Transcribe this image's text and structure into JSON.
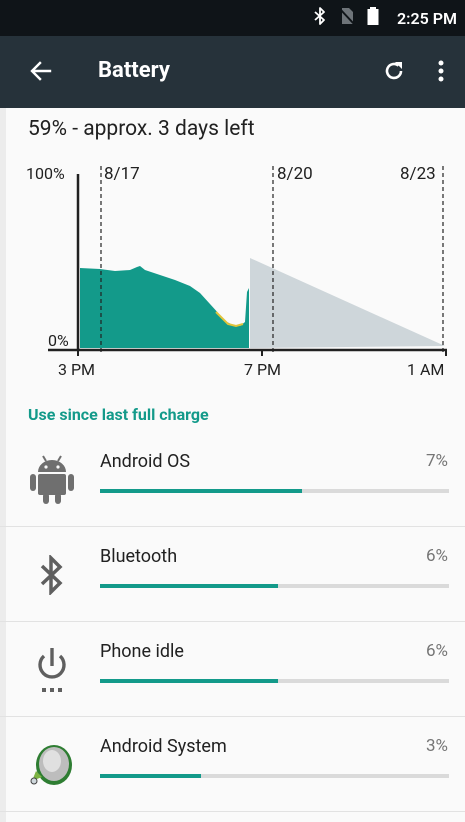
{
  "status_bar": {
    "time": "2:25 PM",
    "icons": [
      "bluetooth-icon",
      "no-sim-icon",
      "battery-icon"
    ]
  },
  "app_bar": {
    "title": "Battery",
    "back_icon": "arrow-back-icon",
    "refresh_icon": "refresh-icon",
    "menu_icon": "more-vert-icon"
  },
  "summary": "59% - approx. 3 days left",
  "chart": {
    "y_labels": {
      "top": "100%",
      "bottom": "0%"
    },
    "date_labels": [
      "8/17",
      "8/20",
      "8/23"
    ],
    "time_labels": [
      "3 PM",
      "7 PM",
      "1 AM"
    ],
    "colors": {
      "used": "#139A8A",
      "predicted": "#CED6DA",
      "axis": "#212121"
    }
  },
  "section_header": "Use since last full charge",
  "apps": [
    {
      "name": "Android OS",
      "percent": "7%",
      "bar_fraction": 0.58,
      "icon": "android-icon"
    },
    {
      "name": "Bluetooth",
      "percent": "6%",
      "bar_fraction": 0.51,
      "icon": "bluetooth-icon"
    },
    {
      "name": "Phone idle",
      "percent": "6%",
      "bar_fraction": 0.51,
      "icon": "power-icon"
    },
    {
      "name": "Android System",
      "percent": "3%",
      "bar_fraction": 0.29,
      "icon": "android-system-icon"
    }
  ]
}
